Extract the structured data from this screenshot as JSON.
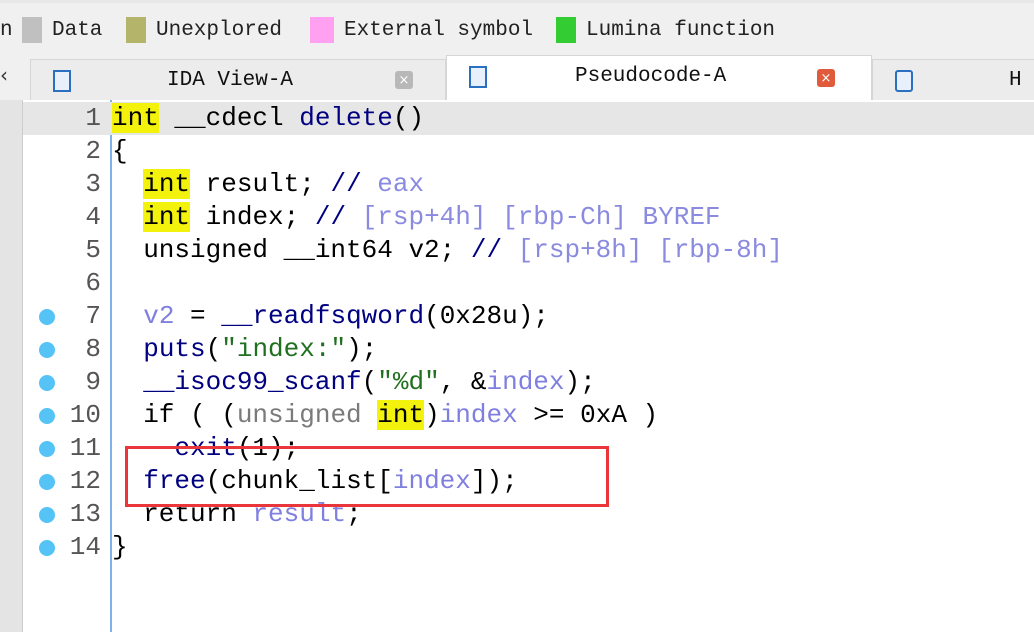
{
  "legend": [
    {
      "label": "n",
      "color": null
    },
    {
      "label": "Data",
      "color": "#c0c0c0"
    },
    {
      "label": "Unexplored",
      "color": "#b4b46a"
    },
    {
      "label": "External symbol",
      "color": "#ffa0f0"
    },
    {
      "label": "Lumina function",
      "color": "#33cc33"
    }
  ],
  "tabs": [
    {
      "label": "IDA View-A",
      "active": false
    },
    {
      "label": "Pseudocode-A",
      "active": true
    },
    {
      "label": "H",
      "active": false
    }
  ],
  "close_glyph": "×",
  "code": [
    {
      "n": "1",
      "bp": false,
      "tokens": [
        [
          "int",
          "kw"
        ],
        [
          " __cdecl ",
          "id"
        ],
        [
          "delete",
          "fn"
        ],
        [
          "()",
          "id"
        ]
      ]
    },
    {
      "n": "2",
      "bp": false,
      "tokens": [
        [
          "{",
          "id"
        ]
      ]
    },
    {
      "n": "3",
      "bp": false,
      "tokens": [
        [
          "  ",
          "id"
        ],
        [
          "int",
          "kw"
        ],
        [
          " result; ",
          "id"
        ],
        [
          "// ",
          "cm"
        ],
        [
          "eax",
          "cmt"
        ]
      ]
    },
    {
      "n": "4",
      "bp": false,
      "tokens": [
        [
          "  ",
          "id"
        ],
        [
          "int",
          "kw"
        ],
        [
          " index; ",
          "id"
        ],
        [
          "// ",
          "cm"
        ],
        [
          "[rsp+4h] [rbp-Ch] BYREF",
          "cmt"
        ]
      ]
    },
    {
      "n": "5",
      "bp": false,
      "tokens": [
        [
          "  unsigned __int64 v2; ",
          "id"
        ],
        [
          "// ",
          "cm"
        ],
        [
          "[rsp+8h] [rbp-8h]",
          "cmt"
        ]
      ]
    },
    {
      "n": "6",
      "bp": false,
      "tokens": []
    },
    {
      "n": "7",
      "bp": true,
      "tokens": [
        [
          "  ",
          "id"
        ],
        [
          "v2",
          "var"
        ],
        [
          " = ",
          "id"
        ],
        [
          "__readfsqword",
          "fn"
        ],
        [
          "(0x28u);",
          "id"
        ]
      ]
    },
    {
      "n": "8",
      "bp": true,
      "tokens": [
        [
          "  ",
          "id"
        ],
        [
          "puts",
          "fn"
        ],
        [
          "(",
          "id"
        ],
        [
          "\"index:\"",
          "str"
        ],
        [
          ");",
          "id"
        ]
      ]
    },
    {
      "n": "9",
      "bp": true,
      "tokens": [
        [
          "  ",
          "id"
        ],
        [
          "__isoc99_scanf",
          "fn"
        ],
        [
          "(",
          "id"
        ],
        [
          "\"%d\"",
          "str"
        ],
        [
          ", &",
          "id"
        ],
        [
          "index",
          "var"
        ],
        [
          ");",
          "id"
        ]
      ]
    },
    {
      "n": "10",
      "bp": true,
      "tokens": [
        [
          "  if ( (",
          "id"
        ],
        [
          "unsigned ",
          "cast"
        ],
        [
          "int",
          "kw"
        ],
        [
          ")",
          "id"
        ],
        [
          "index",
          "var"
        ],
        [
          " >= 0xA )",
          "id"
        ]
      ]
    },
    {
      "n": "11",
      "bp": true,
      "tokens": [
        [
          "    ",
          "id"
        ],
        [
          "exit",
          "fn"
        ],
        [
          "(1);",
          "id"
        ]
      ]
    },
    {
      "n": "12",
      "bp": true,
      "tokens": [
        [
          "  ",
          "id"
        ],
        [
          "free",
          "fn"
        ],
        [
          "(chunk_list[",
          "id"
        ],
        [
          "index",
          "var"
        ],
        [
          "]);",
          "id"
        ]
      ]
    },
    {
      "n": "13",
      "bp": true,
      "tokens": [
        [
          "  return ",
          "id"
        ],
        [
          "result",
          "var"
        ],
        [
          ";",
          "id"
        ]
      ]
    },
    {
      "n": "14",
      "bp": true,
      "tokens": [
        [
          "}",
          "id"
        ]
      ]
    }
  ]
}
